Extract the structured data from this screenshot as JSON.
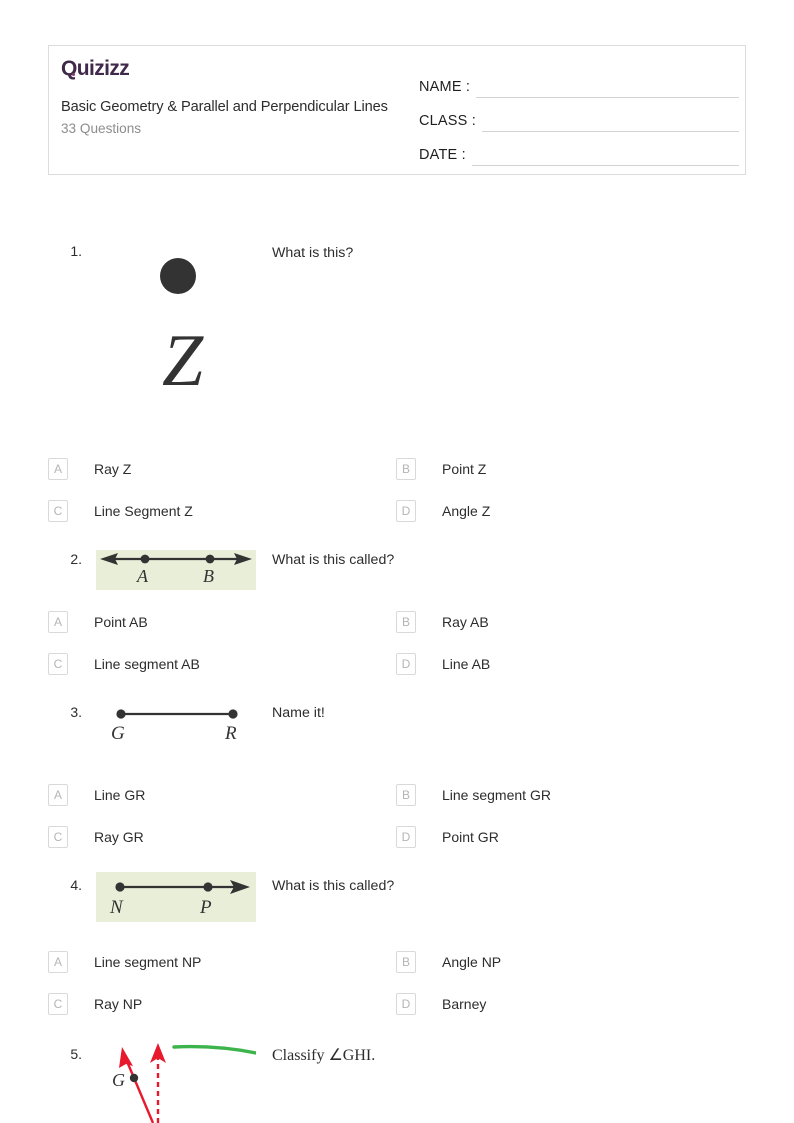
{
  "header": {
    "logo": "Quizizz",
    "title": "Basic Geometry & Parallel and Perpendicular Lines",
    "question_count": "33 Questions",
    "fields": [
      {
        "label": "NAME :",
        "value": ""
      },
      {
        "label": "CLASS :",
        "value": ""
      },
      {
        "label": "DATE  :",
        "value": ""
      }
    ]
  },
  "colors": {
    "logo": "#40294a",
    "media_green": "#e9eed9",
    "diagram_dark": "#333333",
    "diagram_red": "#e8192c",
    "diagram_green": "#3cb44b",
    "option_letter": "#b5b5b5",
    "border": "#dcdcdc"
  },
  "questions": [
    {
      "number": "1.",
      "text": "What is this?",
      "media": {
        "type": "point-z",
        "background": "#ffffff",
        "labels": [
          "Z"
        ]
      },
      "options": [
        {
          "letter": "A",
          "label": "Ray Z"
        },
        {
          "letter": "B",
          "label": "Point Z"
        },
        {
          "letter": "C",
          "label": "Line Segment Z"
        },
        {
          "letter": "D",
          "label": "Angle Z"
        }
      ]
    },
    {
      "number": "2.",
      "text": "What is this called?",
      "media": {
        "type": "line-two-arrows",
        "background": "#e9eed9",
        "labels": [
          "A",
          "B"
        ]
      },
      "options": [
        {
          "letter": "A",
          "label": "Point AB"
        },
        {
          "letter": "B",
          "label": "Ray AB"
        },
        {
          "letter": "C",
          "label": "Line segment AB"
        },
        {
          "letter": "D",
          "label": "Line AB"
        }
      ]
    },
    {
      "number": "3.",
      "text": "Name it!",
      "media": {
        "type": "line-segment",
        "background": "#ffffff",
        "labels": [
          "G",
          "R"
        ]
      },
      "options": [
        {
          "letter": "A",
          "label": "Line GR"
        },
        {
          "letter": "B",
          "label": "Line segment GR"
        },
        {
          "letter": "C",
          "label": "Ray GR"
        },
        {
          "letter": "D",
          "label": "Point GR"
        }
      ]
    },
    {
      "number": "4.",
      "text": "What is this called?",
      "media": {
        "type": "ray-right-arrow",
        "background": "#e9eed9",
        "labels": [
          "N",
          "P"
        ]
      },
      "options": [
        {
          "letter": "A",
          "label": "Line segment NP"
        },
        {
          "letter": "B",
          "label": "Angle NP"
        },
        {
          "letter": "C",
          "label": "Ray NP"
        },
        {
          "letter": "D",
          "label": "Barney"
        }
      ]
    },
    {
      "number": "5.",
      "text": "Classify ∠GHI.",
      "media": {
        "type": "angle-red-arrows",
        "background": "#ffffff",
        "labels": [
          "G"
        ]
      },
      "options": []
    }
  ]
}
